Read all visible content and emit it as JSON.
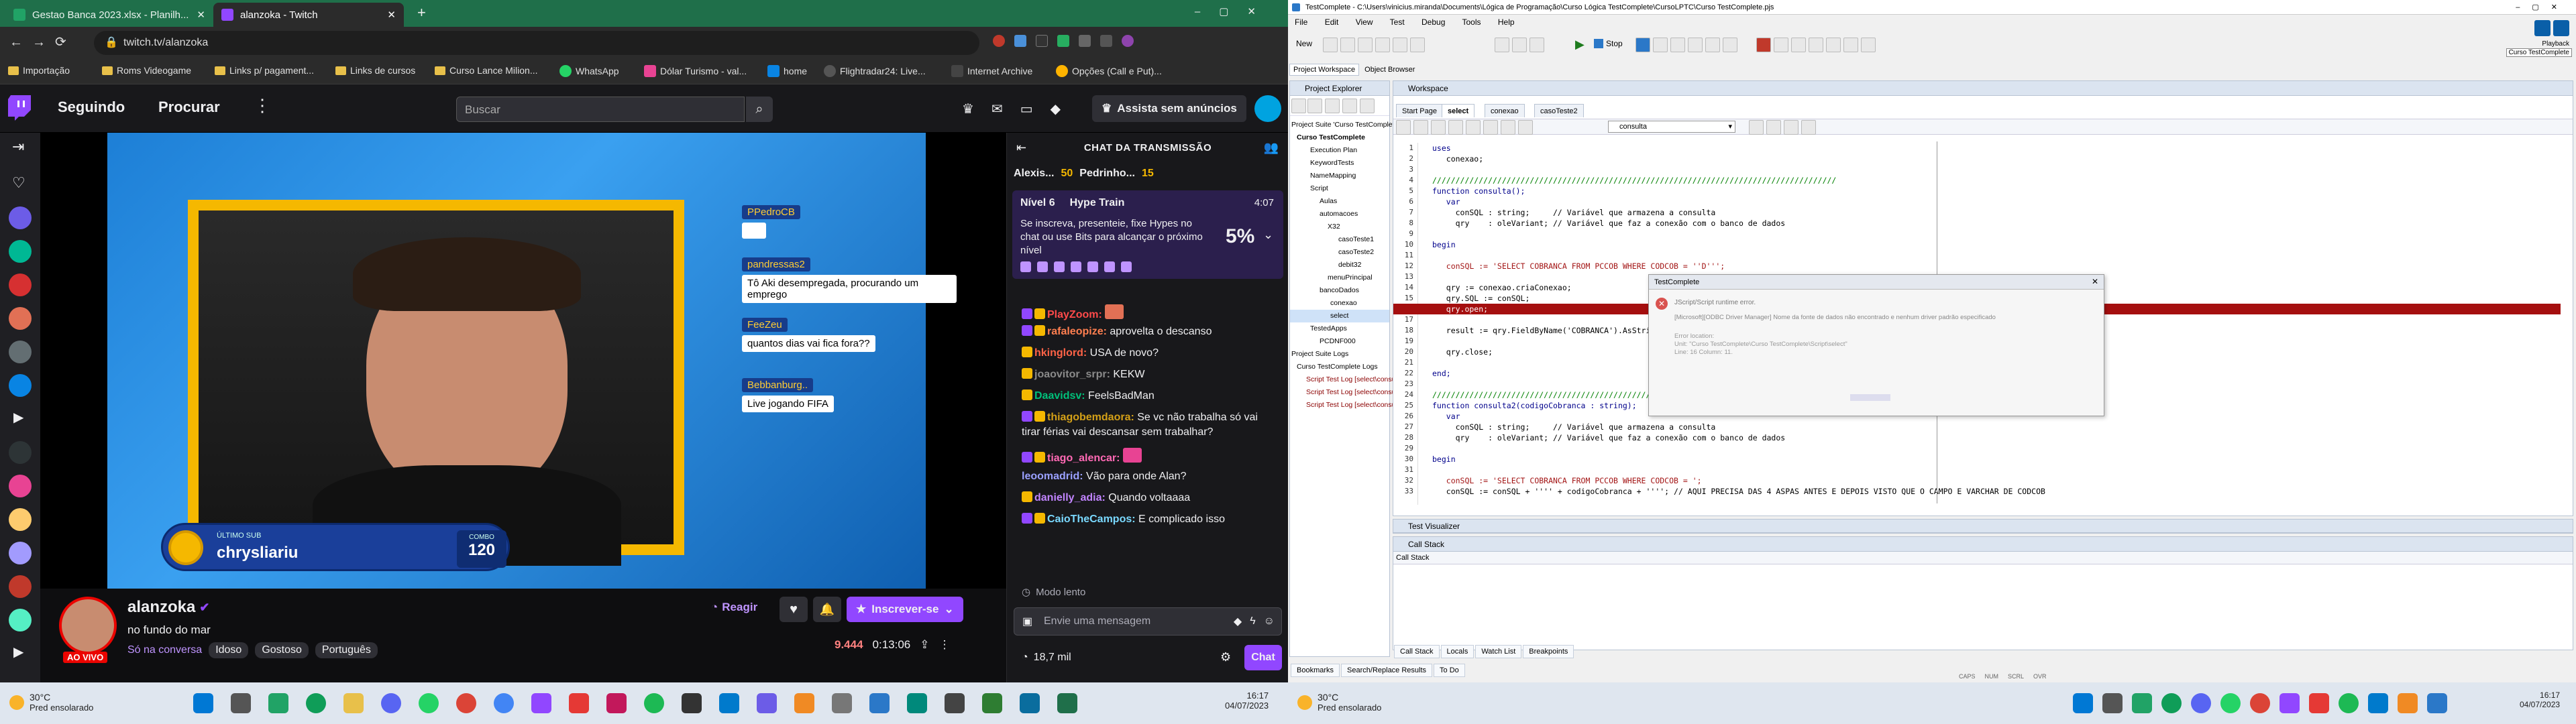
{
  "colors": {
    "twitch_purple": "#9147ff",
    "chrome_green": "#1f6f4a",
    "live_red": "#eb0400",
    "error_red": "#a50f0f",
    "tc_blue": "#2b78c8"
  },
  "chrome": {
    "tab1_title": "Gestao Banca 2023.xlsx - Planilh...",
    "tab2_title": "alanzoka - Twitch",
    "url": "twitch.tv/alanzoka",
    "bookmarks": [
      "Importação",
      "Roms Videogame",
      "Links p/ pagament...",
      "Links de cursos",
      "Curso Lance Milion...",
      "WhatsApp",
      "Dólar Turismo - val...",
      "home",
      "Flightradar24: Live...",
      "Internet Archive",
      "Opções (Call e Put)..."
    ]
  },
  "twitch": {
    "nav_following": "Seguindo",
    "nav_browse": "Procurar",
    "search_placeholder": "Buscar",
    "prime": "Assista sem anúncios",
    "overlay_chat": [
      {
        "user": "PPedroCB",
        "text": "",
        "color": "#f5a623"
      },
      {
        "user": "pandressas2",
        "text": "Tô Aki desempregada, procurando um emprego",
        "color": "#ffcc33"
      },
      {
        "user": "FeeZeu",
        "text": "quantos dias vai fica fora??",
        "color": "#ffcc33"
      },
      {
        "user": "Bebbanburg..",
        "text": "Live jogando FIFA",
        "color": "#ffcc33"
      }
    ],
    "last_sub_label": "ÚLTIMO SUB",
    "last_sub_name": "chrysliariu",
    "combo_label": "COMBO",
    "combo_value": "120",
    "channel": "alanzoka",
    "stream_title": "no fundo do mar",
    "category": "Só na conversa",
    "tags": [
      "Idoso",
      "Gostoso",
      "Português"
    ],
    "live": "AO VIVO",
    "viewers": "9.444",
    "uptime": "0:13:06",
    "react": "Reagir",
    "subscribe": "Inscrever-se"
  },
  "chat": {
    "header": "CHAT DA TRANSMISSÃO",
    "top_users": [
      {
        "name": "Alexis...",
        "count": ""
      },
      {
        "name": "50",
        "count": ""
      },
      {
        "name": "Pedrinho...",
        "count": ""
      },
      {
        "name": "15",
        "count": ""
      }
    ],
    "hype_level": "Nível 6",
    "hype_title": "Hype Train",
    "hype_time": "4:07",
    "hype_text": "Se inscreva, presenteie, fixe Hypes no chat ou use Bits para alcançar o próximo nível",
    "hype_pct": "5%",
    "messages": [
      {
        "user": "PlayZoom:",
        "text": "",
        "color": "#ff4a4a"
      },
      {
        "user": "rafaleopize:",
        "text": "aprovelta o descanso",
        "color": "#ff7f50"
      },
      {
        "user": "hkinglord:",
        "text": "USA de novo?",
        "color": "#ff6347"
      },
      {
        "user": "joaovitor_srpr:",
        "text": "KEKW",
        "color": "#8a8a8a"
      },
      {
        "user": "Daavidsv:",
        "text": "FeelsBadMan",
        "color": "#00c07a"
      },
      {
        "user": "thiagobemdaora:",
        "text": "Se vc não trabalha só vai tirar férias vai descansar sem trabalhar?",
        "color": "#d4a017"
      },
      {
        "user": "tiago_alencar:",
        "text": "",
        "color": "#ff69b4"
      },
      {
        "user": "leoomadrid:",
        "text": "Vão para onde Alan?",
        "color": "#9aa0ff"
      },
      {
        "user": "danielly_adia:",
        "text": "Quando voltaaaa",
        "color": "#c184ff"
      },
      {
        "user": "CaioTheCampos:",
        "text": "E complicado isso",
        "color": "#7ad9ff"
      }
    ],
    "slow_mode": "Modo lento",
    "input_placeholder": "Envie uma mensagem",
    "points": "18,7 mil",
    "send": "Chat"
  },
  "taskbar1": {
    "temp": "30°C",
    "weather": "Pred ensolarado",
    "time": "16:17",
    "date": "04/07/2023"
  },
  "tc": {
    "title": "TestComplete - C:\\Users\\vinicius.miranda\\Documents\\Lógica de Programação\\Curso Lógica TestComplete\\CursoLPTC\\Curso TestComplete.pjs",
    "menu": [
      "File",
      "Edit",
      "View",
      "Test",
      "Debug",
      "Tools",
      "Help"
    ],
    "new_label": "New",
    "stop_label": "Stop",
    "playback_tooltip": "Playback",
    "course_tooltip": "Curso TestComplete",
    "workspace_tabs": [
      "Project Workspace",
      "Object Browser"
    ],
    "explorer_title": "Project Explorer",
    "tree": [
      "Project Suite 'Curso TestComplete' (1 pr",
      "Curso TestComplete",
      "Execution Plan",
      "KeywordTests",
      "NameMapping",
      "Script",
      "Aulas",
      "automacoes",
      "X32",
      "casoTeste1",
      "casoTeste2",
      "debit32",
      "menuPrincipal",
      "bancoDados",
      "conexao",
      "select",
      "TestedApps",
      "PCDNF000",
      "Project Suite Logs",
      "Curso TestComplete Logs",
      "Script Test Log [select\\consulta]",
      "Script Test Log [select\\consulta]",
      "Script Test Log [select\\consulta]"
    ],
    "workspace_title": "Workspace",
    "editor_tabs": [
      "Start Page",
      "select",
      "conexao",
      "casoTeste2"
    ],
    "routine": "consulta",
    "code": [
      "uses",
      "   conexao;",
      "",
      "///////////////////////////////////////////////////////////////////////////////////////",
      "function consulta();",
      "   var",
      "     conSQL : string;     // Variável que armazena a consulta",
      "     qry    : oleVariant; // Variável que faz a conexão com o banco de dados",
      "",
      "begin",
      "",
      "   conSQL := 'SELECT COBRANCA FROM PCCOB WHERE CODCOB = ''D''';",
      "",
      "   qry := conexao.criaConexao;",
      "   qry.SQL := conSQL;",
      "   qry.open;",
      "",
      "   result := qry.FieldByName('COBRANCA').AsString;",
      "",
      "   qry.close;",
      "",
      "end;",
      "",
      "///////////////////////////////////////////////////////////////////////////////////////",
      "function consulta2(codigoCobranca : string);",
      "   var",
      "     conSQL : string;     // Variável que armazena a consulta",
      "     qry    : oleVariant; // Variável que faz a conexão com o banco de dados",
      "",
      "begin",
      "",
      "   conSQL := 'SELECT COBRANCA FROM PCCOB WHERE CODCOB = ';",
      "   conSQL := conSQL + '''' + codigoCobranca + ''''; // AQUI PRECISA DAS 4 ASPAS ANTES E DEPOIS VISTO QUE O CAMPO E VARCHAR DE CODCOB"
    ],
    "line_numbers": [
      "1",
      "2",
      "3",
      "4",
      "5",
      "6",
      "7",
      "8",
      "9",
      "10",
      "11",
      "12",
      "13",
      "14",
      "15",
      "16",
      "17",
      "18",
      "19",
      "20",
      "21",
      "22",
      "23",
      "24",
      "25",
      "26",
      "27",
      "28",
      "29",
      "30",
      "31",
      "32",
      "33"
    ],
    "error_dialog": {
      "title": "TestComplete",
      "heading": "JScript/Script runtime error.",
      "message": "[Microsoft][ODBC Driver Manager] Nome da fonte de dados não encontrado e nenhum driver padrão especificado",
      "loc_label": "Error location:",
      "loc_unit": "Unit: \"Curso TestComplete\\Curso TestComplete\\Script\\select\"",
      "loc_line": "Line: 16 Column: 11."
    },
    "test_visualizer": "Test Visualizer",
    "call_stack_title": "Call Stack",
    "call_stack_col": "Call Stack",
    "bottom_tabs": [
      "Call Stack",
      "Locals",
      "Watch List",
      "Breakpoints"
    ],
    "left_bottom_tabs": [
      "Bookmarks",
      "Search/Replace Results",
      "To Do"
    ],
    "status": [
      "CAPS",
      "NUM",
      "SCRL",
      "OVR"
    ]
  },
  "taskbar2": {
    "temp": "30°C",
    "weather": "Pred ensolarado",
    "time": "16:17",
    "date": "04/07/2023"
  }
}
